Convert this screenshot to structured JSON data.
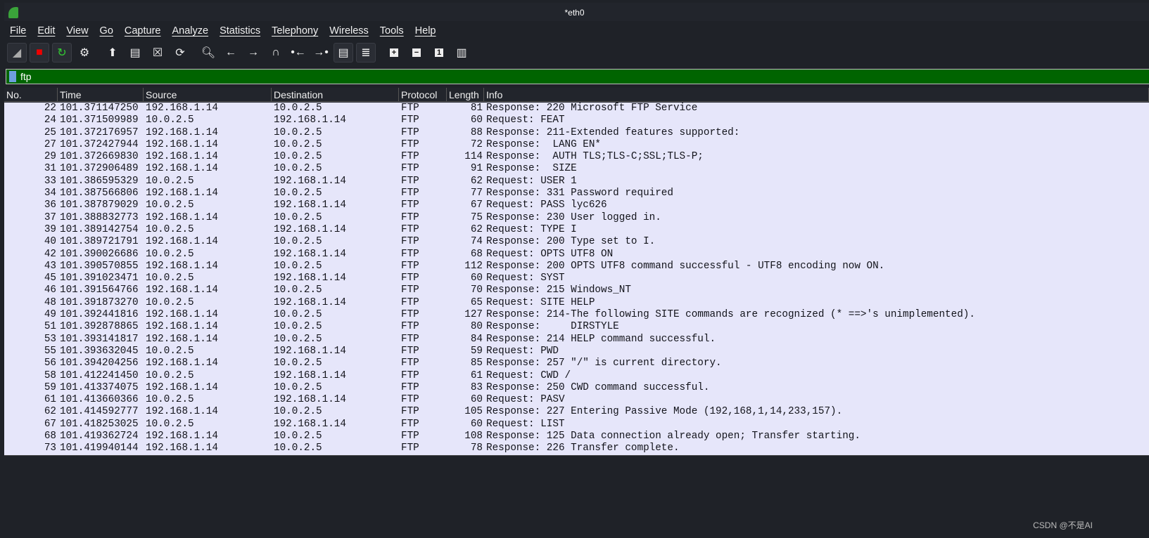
{
  "window": {
    "title": "*eth0",
    "watermark": "CSDN @不是AI"
  },
  "menu": [
    "File",
    "Edit",
    "View",
    "Go",
    "Capture",
    "Analyze",
    "Statistics",
    "Telephony",
    "Wireless",
    "Tools",
    "Help"
  ],
  "toolbar": [
    "start-capture-icon",
    "stop-capture-icon",
    "restart-capture-icon",
    "capture-options-icon",
    "open-file-icon",
    "save-file-icon",
    "close-file-icon",
    "reload-file-icon",
    "find-packet-icon",
    "go-back-icon",
    "go-forward-icon",
    "go-to-packet-icon",
    "first-packet-icon",
    "last-packet-icon",
    "autoscroll-icon",
    "colorize-icon",
    "zoom-in-icon",
    "zoom-out-icon",
    "normal-size-icon",
    "resize-columns-icon"
  ],
  "filter": {
    "value": "ftp",
    "bg_color": "#006400"
  },
  "columns": [
    "No.",
    "Time",
    "Source",
    "Destination",
    "Protocol",
    "Length",
    "Info"
  ],
  "rows": [
    [
      "22",
      "101.371147250",
      "192.168.1.14",
      "10.0.2.5",
      "FTP",
      "81",
      "Response: 220 Microsoft FTP Service"
    ],
    [
      "24",
      "101.371509989",
      "10.0.2.5",
      "192.168.1.14",
      "FTP",
      "60",
      "Request: FEAT"
    ],
    [
      "25",
      "101.372176957",
      "192.168.1.14",
      "10.0.2.5",
      "FTP",
      "88",
      "Response: 211-Extended features supported:"
    ],
    [
      "27",
      "101.372427944",
      "192.168.1.14",
      "10.0.2.5",
      "FTP",
      "72",
      "Response:  LANG EN*"
    ],
    [
      "29",
      "101.372669830",
      "192.168.1.14",
      "10.0.2.5",
      "FTP",
      "114",
      "Response:  AUTH TLS;TLS-C;SSL;TLS-P;"
    ],
    [
      "31",
      "101.372906489",
      "192.168.1.14",
      "10.0.2.5",
      "FTP",
      "91",
      "Response:  SIZE"
    ],
    [
      "33",
      "101.386595329",
      "10.0.2.5",
      "192.168.1.14",
      "FTP",
      "62",
      "Request: USER 1"
    ],
    [
      "34",
      "101.387566806",
      "192.168.1.14",
      "10.0.2.5",
      "FTP",
      "77",
      "Response: 331 Password required"
    ],
    [
      "36",
      "101.387879029",
      "10.0.2.5",
      "192.168.1.14",
      "FTP",
      "67",
      "Request: PASS lyc626"
    ],
    [
      "37",
      "101.388832773",
      "192.168.1.14",
      "10.0.2.5",
      "FTP",
      "75",
      "Response: 230 User logged in."
    ],
    [
      "39",
      "101.389142754",
      "10.0.2.5",
      "192.168.1.14",
      "FTP",
      "62",
      "Request: TYPE I"
    ],
    [
      "40",
      "101.389721791",
      "192.168.1.14",
      "10.0.2.5",
      "FTP",
      "74",
      "Response: 200 Type set to I."
    ],
    [
      "42",
      "101.390026686",
      "10.0.2.5",
      "192.168.1.14",
      "FTP",
      "68",
      "Request: OPTS UTF8 ON"
    ],
    [
      "43",
      "101.390570855",
      "192.168.1.14",
      "10.0.2.5",
      "FTP",
      "112",
      "Response: 200 OPTS UTF8 command successful - UTF8 encoding now ON."
    ],
    [
      "45",
      "101.391023471",
      "10.0.2.5",
      "192.168.1.14",
      "FTP",
      "60",
      "Request: SYST"
    ],
    [
      "46",
      "101.391564766",
      "192.168.1.14",
      "10.0.2.5",
      "FTP",
      "70",
      "Response: 215 Windows_NT"
    ],
    [
      "48",
      "101.391873270",
      "10.0.2.5",
      "192.168.1.14",
      "FTP",
      "65",
      "Request: SITE HELP"
    ],
    [
      "49",
      "101.392441816",
      "192.168.1.14",
      "10.0.2.5",
      "FTP",
      "127",
      "Response: 214-The following SITE commands are recognized (* ==>'s unimplemented)."
    ],
    [
      "51",
      "101.392878865",
      "192.168.1.14",
      "10.0.2.5",
      "FTP",
      "80",
      "Response:     DIRSTYLE"
    ],
    [
      "53",
      "101.393141817",
      "192.168.1.14",
      "10.0.2.5",
      "FTP",
      "84",
      "Response: 214 HELP command successful."
    ],
    [
      "55",
      "101.393632045",
      "10.0.2.5",
      "192.168.1.14",
      "FTP",
      "59",
      "Request: PWD"
    ],
    [
      "56",
      "101.394204256",
      "192.168.1.14",
      "10.0.2.5",
      "FTP",
      "85",
      "Response: 257 \"/\" is current directory."
    ],
    [
      "58",
      "101.412241450",
      "10.0.2.5",
      "192.168.1.14",
      "FTP",
      "61",
      "Request: CWD /"
    ],
    [
      "59",
      "101.413374075",
      "192.168.1.14",
      "10.0.2.5",
      "FTP",
      "83",
      "Response: 250 CWD command successful."
    ],
    [
      "61",
      "101.413660366",
      "10.0.2.5",
      "192.168.1.14",
      "FTP",
      "60",
      "Request: PASV"
    ],
    [
      "62",
      "101.414592777",
      "192.168.1.14",
      "10.0.2.5",
      "FTP",
      "105",
      "Response: 227 Entering Passive Mode (192,168,1,14,233,157)."
    ],
    [
      "67",
      "101.418253025",
      "10.0.2.5",
      "192.168.1.14",
      "FTP",
      "60",
      "Request: LIST"
    ],
    [
      "68",
      "101.419362724",
      "192.168.1.14",
      "10.0.2.5",
      "FTP",
      "108",
      "Response: 125 Data connection already open; Transfer starting."
    ],
    [
      "73",
      "101.419940144",
      "192.168.1.14",
      "10.0.2.5",
      "FTP",
      "78",
      "Response: 226 Transfer complete."
    ]
  ]
}
